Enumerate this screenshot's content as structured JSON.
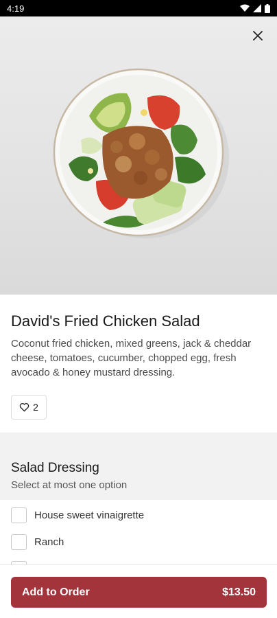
{
  "status_bar": {
    "time": "4:19"
  },
  "hero": {
    "image_alt": "Salad with fried chicken, avocado, tomatoes and greens in a white bowl"
  },
  "item": {
    "title": "David's Fried Chicken Salad",
    "description": "Coconut fried chicken, mixed greens, jack & cheddar cheese, tomatoes, cucumber, chopped egg, fresh avocado & honey mustard dressing.",
    "likes": "2"
  },
  "section": {
    "title": "Salad Dressing",
    "subtitle": "Select at most one option",
    "options": [
      {
        "label": "House sweet vinaigrette"
      },
      {
        "label": "Ranch"
      }
    ]
  },
  "footer": {
    "button_label": "Add to Order",
    "price": "$13.50"
  },
  "colors": {
    "accent": "#a4343c"
  },
  "icons": {
    "close": "close-icon",
    "heart": "heart-icon"
  }
}
